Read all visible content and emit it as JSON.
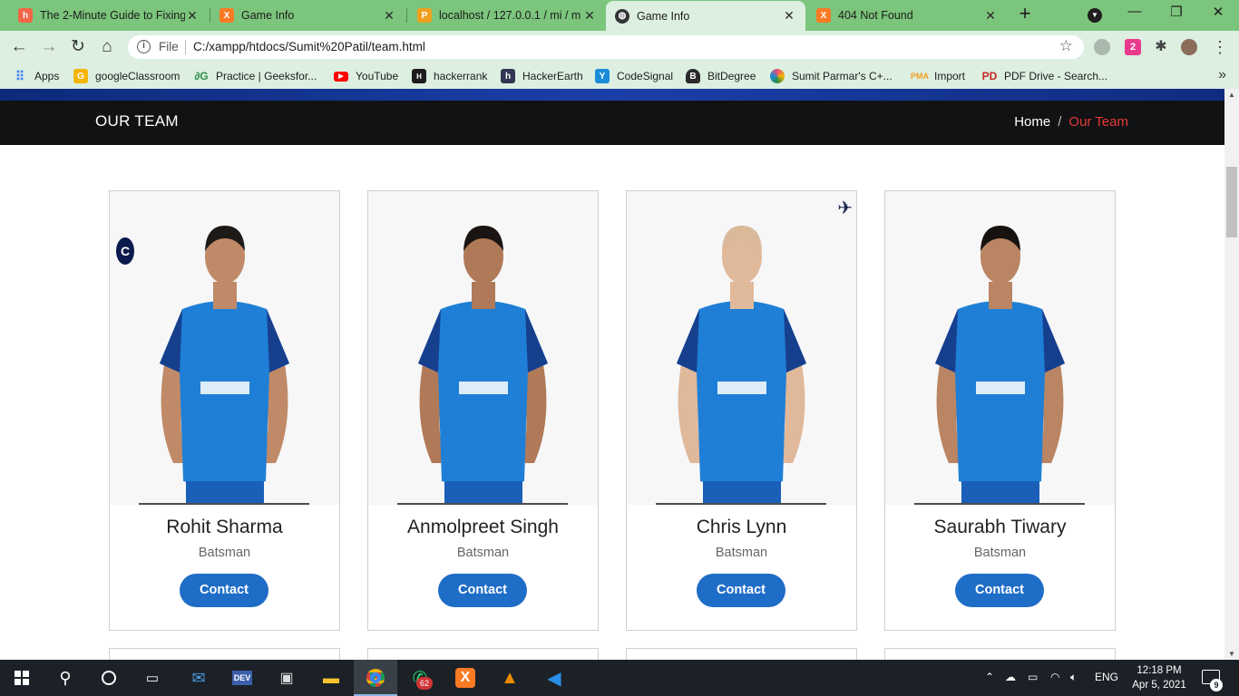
{
  "browser": {
    "tabs": [
      {
        "title": "The 2-Minute Guide to Fixing",
        "icon": "hacker-noon-icon",
        "color": "#f26649",
        "glyph": "h"
      },
      {
        "title": "Game Info",
        "icon": "xampp-icon",
        "color": "#fb7a24",
        "glyph": "X"
      },
      {
        "title": "localhost / 127.0.0.1 / mi / m",
        "icon": "phpmyadmin-icon",
        "color": "#f0a020",
        "glyph": "P"
      },
      {
        "title": "Game Info",
        "icon": "globe-icon",
        "color": "#333333",
        "glyph": "◍"
      },
      {
        "title": "404 Not Found",
        "icon": "xampp-icon",
        "color": "#fb7a24",
        "glyph": "X"
      }
    ],
    "active_tab": 3,
    "new_tab": "+",
    "tab_search_icon": "chevron-down-icon",
    "window_controls": {
      "minimize": "—",
      "restore": "❐",
      "close": "✕"
    },
    "toolbar": {
      "back": "←",
      "forward": "→",
      "reload": "↻",
      "home": "⌂",
      "scheme_label": "File",
      "url": "C:/xampp/htdocs/Sumit%20Patil/team.html",
      "bookmark_star": "☆",
      "extension_badge": "2",
      "menu": "⋮"
    },
    "bookmarks": [
      {
        "label": "Apps",
        "icon": "apps-grid-icon",
        "color": "#4285f4",
        "glyph": "⠿"
      },
      {
        "label": "googleClassroom",
        "icon": "classroom-icon",
        "color": "#f4b400",
        "glyph": "G"
      },
      {
        "label": "Practice | Geeksfor...",
        "icon": "geeksforgeeks-icon",
        "color": "#2f8d46",
        "glyph": "∂"
      },
      {
        "label": "YouTube",
        "icon": "youtube-icon",
        "color": "#ff0000",
        "glyph": "▶"
      },
      {
        "label": "hackerrank",
        "icon": "hackerrank-icon",
        "color": "#1d1d1d",
        "glyph": "H"
      },
      {
        "label": "HackerEarth",
        "icon": "hackerearth-icon",
        "color": "#323754",
        "glyph": "h"
      },
      {
        "label": "CodeSignal",
        "icon": "codesignal-icon",
        "color": "#1a8cd8",
        "glyph": "Y"
      },
      {
        "label": "BitDegree",
        "icon": "bitdegree-icon",
        "color": "#2b2b2b",
        "glyph": "B"
      },
      {
        "label": "Sumit Parmar's C+...",
        "icon": "colorful-ring-icon",
        "color": "#e94e77",
        "glyph": "◎"
      },
      {
        "label": "Import",
        "icon": "phpmyadmin-icon",
        "color": "#f0a020",
        "glyph": "P"
      },
      {
        "label": "PDF Drive - Search...",
        "icon": "pdf-drive-icon",
        "color": "#c62828",
        "glyph": "P"
      }
    ],
    "bookmarks_more": "»"
  },
  "page": {
    "header_title": "OUR TEAM",
    "breadcrumb_home": "Home",
    "breadcrumb_separator": "/",
    "breadcrumb_current": "Our Team",
    "accent_color": "#e53935",
    "button_color": "#1e6dc7",
    "players": [
      {
        "name": "Rohit Sharma",
        "role": "Batsman",
        "button": "Contact",
        "badge": "C",
        "skin": "#c08a68",
        "hair": "#1e1a18"
      },
      {
        "name": "Anmolpreet Singh",
        "role": "Batsman",
        "button": "Contact",
        "skin": "#b07a58",
        "hair": "#1a1512"
      },
      {
        "name": "Chris Lynn",
        "role": "Batsman",
        "button": "Contact",
        "plane": "✈",
        "skin": "#e0b89a",
        "hair": "#d9b99a"
      },
      {
        "name": "Saurabh Tiwary",
        "role": "Batsman",
        "button": "Contact",
        "skin": "#b98562",
        "hair": "#161210"
      }
    ]
  },
  "scrollbar": {
    "up": "▲",
    "down": "▼"
  },
  "taskbar": {
    "whatsapp_badge": "62",
    "language": "ENG",
    "time": "12:18 PM",
    "date": "Apr 5, 2021",
    "notification_count": "9"
  }
}
